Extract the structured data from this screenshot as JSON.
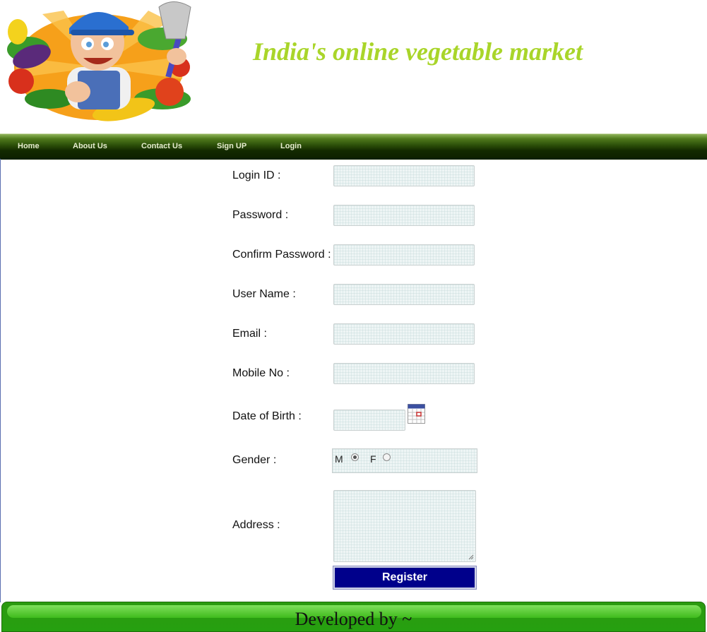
{
  "header": {
    "title": "India's online vegetable market",
    "logo_alt": "cartoon farmer with vegetables"
  },
  "nav": {
    "items": [
      {
        "label": "Home"
      },
      {
        "label": "About Us"
      },
      {
        "label": "Contact Us"
      },
      {
        "label": "Sign UP"
      },
      {
        "label": "Login"
      }
    ]
  },
  "form": {
    "login_id_label": "Login ID :",
    "password_label": "Password :",
    "confirm_password_label": "Confirm Password :",
    "user_name_label": "User Name :",
    "email_label": "Email :",
    "mobile_label": "Mobile No :",
    "dob_label": "Date of Birth :",
    "gender_label": "Gender :",
    "gender_m": "M",
    "gender_f": "F",
    "gender_selected": "M",
    "address_label": "Address :",
    "register_label": "Register"
  },
  "footer": {
    "text": "Developed by ~"
  },
  "colors": {
    "title": "#a9d52a",
    "nav_dark": "#132a00",
    "register_bg": "#00008b",
    "footer_green": "#26a010"
  },
  "icons": [
    "calendar-icon"
  ]
}
